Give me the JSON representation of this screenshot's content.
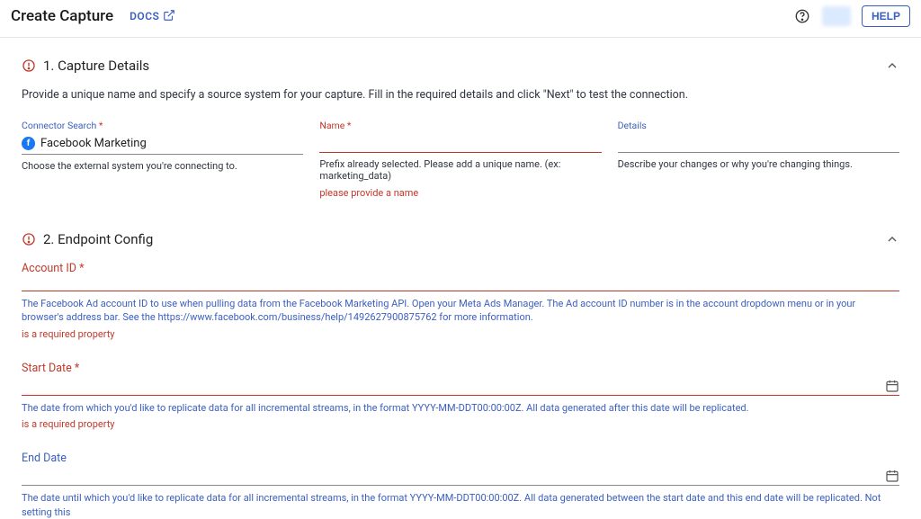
{
  "header": {
    "title": "Create Capture",
    "docs_label": "DOCS",
    "help_label": "HELP"
  },
  "section1": {
    "title": "1. Capture Details",
    "description": "Provide a unique name and specify a source system for your capture. Fill in the required details and click \"Next\" to test the connection.",
    "connector": {
      "label": "Connector Search",
      "value": "Facebook Marketing",
      "help": "Choose the external system you're connecting to."
    },
    "name": {
      "label": "Name",
      "help": "Prefix already selected. Please add a unique name. (ex: marketing_data)",
      "error": "please provide a name"
    },
    "details": {
      "label": "Details",
      "help": "Describe your changes or why you're changing things."
    }
  },
  "section2": {
    "title": "2. Endpoint Config",
    "account_id": {
      "label": "Account ID",
      "help": "The Facebook Ad account ID to use when pulling data from the Facebook Marketing API. Open your Meta Ads Manager. The Ad account ID number is in the account dropdown menu or in your browser's address bar. See the https://www.facebook.com/business/help/1492627900875762 for more information.",
      "error": "is a required property"
    },
    "start_date": {
      "label": "Start Date",
      "help": "The date from which you'd like to replicate data for all incremental streams, in the format YYYY-MM-DDT00:00:00Z. All data generated after this date will be replicated.",
      "error": "is a required property"
    },
    "end_date": {
      "label": "End Date",
      "help": "The date until which you'd like to replicate data for all incremental streams, in the format YYYY-MM-DDT00:00:00Z. All data generated between the start date and this end date will be replicated. Not setting this"
    }
  }
}
